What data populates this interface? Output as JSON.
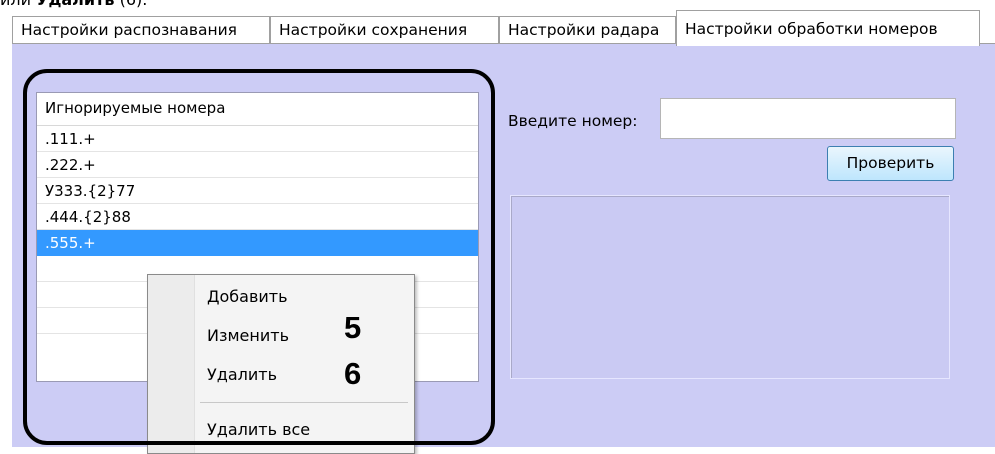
{
  "caption": {
    "prefix": "или ",
    "bold": "Удалить",
    "suffix": " (6)."
  },
  "tabs": [
    "Настройки распознавания",
    "Настройки сохранения",
    "Настройки радара",
    "Настройки обработки номеров"
  ],
  "list": {
    "header": "Игнорируемые номера",
    "items": [
      ".111.+",
      ".222.+",
      "У333.{2}77",
      ".444.{2}88",
      ".555.+"
    ],
    "selected_index": 4
  },
  "context_menu": {
    "items": [
      "Добавить",
      "Изменить",
      "Удалить",
      "Удалить все"
    ]
  },
  "markers": {
    "edit": "5",
    "delete": "6"
  },
  "number_check": {
    "label": "Введите номер:",
    "input_value": "",
    "button_label": "Проверить"
  },
  "colors": {
    "panel_bg": "#ccccf5",
    "selection": "#3399ff"
  }
}
